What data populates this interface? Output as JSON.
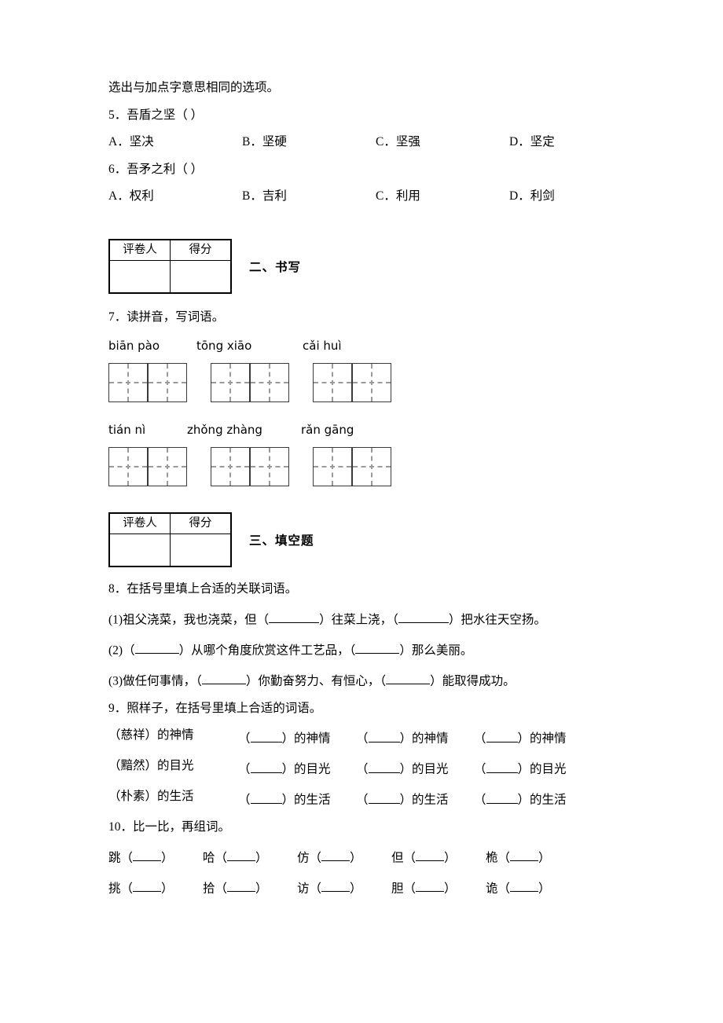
{
  "document": {
    "type": "chinese-language-worksheet"
  },
  "part_one": {
    "stem": "选出与加点字意思相同的选项。",
    "questions": [
      {
        "number": "5",
        "text": "．吾盾之坚（        ）",
        "options": [
          {
            "letter": "A",
            "label": "．坚决"
          },
          {
            "letter": "B",
            "label": "．坚硬"
          },
          {
            "letter": "C",
            "label": "．坚强"
          },
          {
            "letter": "D",
            "label": "．坚定"
          }
        ]
      },
      {
        "number": "6",
        "text": "．吾矛之利（        ）",
        "options": [
          {
            "letter": "A",
            "label": "．权利"
          },
          {
            "letter": "B",
            "label": "．吉利"
          },
          {
            "letter": "C",
            "label": "．利用"
          },
          {
            "letter": "D",
            "label": "．利剑"
          }
        ]
      }
    ]
  },
  "score_table": {
    "grader_label": "评卷人",
    "score_label": "得分",
    "grader_value": "",
    "score_value": ""
  },
  "section_two": {
    "title": "二、书写",
    "question7": {
      "prompt": "7．读拼音，写词语。",
      "pinyin_rows": [
        [
          "biān pào",
          "tōng xiāo",
          "cǎi huì"
        ],
        [
          "tián nì",
          "zhǒng zhàng",
          "rǎn gāng"
        ]
      ],
      "grid_boxes_per_word": 2,
      "words_per_row": 3
    }
  },
  "section_three": {
    "title": "三、填空题",
    "question8": {
      "prompt": "8．在括号里填上合适的关联词语。",
      "items": [
        {
          "index": "(1)",
          "seg1": "祖父浇菜，我也浇菜，但（",
          "seg2": "）往菜上浇，（",
          "seg3": "）把水往天空扬。"
        },
        {
          "index": "(2)",
          "seg1": "（",
          "seg2": "）从哪个角度欣赏这件工艺品，（",
          "seg3": "）那么美丽。"
        },
        {
          "index": "(3)",
          "seg1": "做任何事情，（",
          "seg2": "）你勤奋努力、有恒心，（",
          "seg3": "）能取得成功。"
        }
      ]
    },
    "question9": {
      "prompt": "9．照样子，在括号里填上合适的词语。",
      "rows": [
        {
          "example": "（慈祥）的神情",
          "blanks": [
            "（",
            "）的神情"
          ],
          "count": 3
        },
        {
          "example": "（黯然）的目光",
          "blanks": [
            "（",
            "）的目光"
          ],
          "count": 3
        },
        {
          "example": "（朴素）的生活",
          "blanks": [
            "（",
            "）的生活"
          ],
          "count": 3
        }
      ]
    },
    "question10": {
      "prompt": "10．比一比，再组词。",
      "rows": [
        [
          "跳（",
          "哈（",
          "仿（",
          "但（",
          "桅（"
        ],
        [
          "挑（",
          "拾（",
          "访（",
          "胆（",
          "诡（"
        ]
      ],
      "close": "）"
    }
  }
}
